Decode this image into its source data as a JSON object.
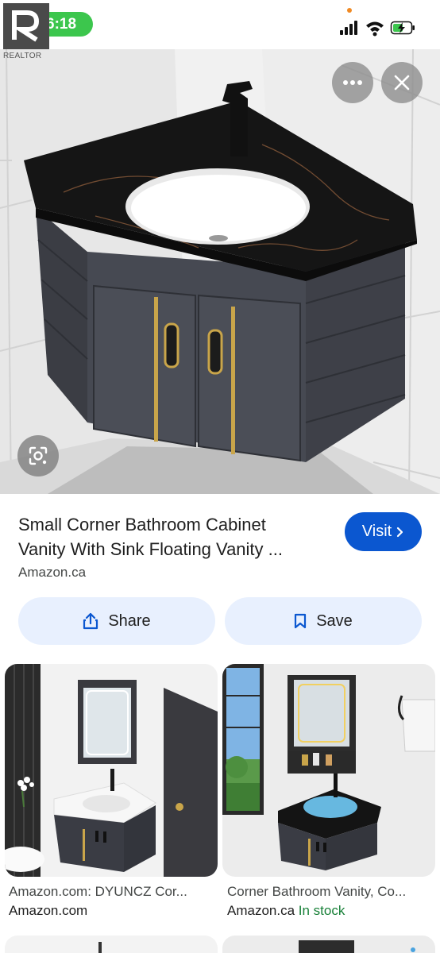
{
  "status_bar": {
    "time": "6:18",
    "watermark": "REALTOR",
    "icons": [
      "signal-icon",
      "wifi-icon",
      "battery-charging-icon"
    ]
  },
  "hero": {
    "more_icon": "more-horiz-icon",
    "close_icon": "close-icon",
    "lens_icon": "lens-icon"
  },
  "result": {
    "title_line1": "Small Corner Bathroom Cabinet",
    "title_line2": "Vanity With Sink Floating Vanity ...",
    "source": "Amazon.ca",
    "visit_label": "Visit",
    "share_label": "Share",
    "save_label": "Save"
  },
  "related": [
    {
      "title": "Amazon.com: DYUNCZ Cor...",
      "source": "Amazon.com",
      "status": ""
    },
    {
      "title": "Corner Bathroom Vanity, Co...",
      "source": "Amazon.ca",
      "status": "In stock"
    }
  ],
  "colors": {
    "accent": "#0b57d0",
    "button_bg": "#e8f0fe",
    "in_stock": "#188038",
    "time_pill": "#3cc64d"
  }
}
